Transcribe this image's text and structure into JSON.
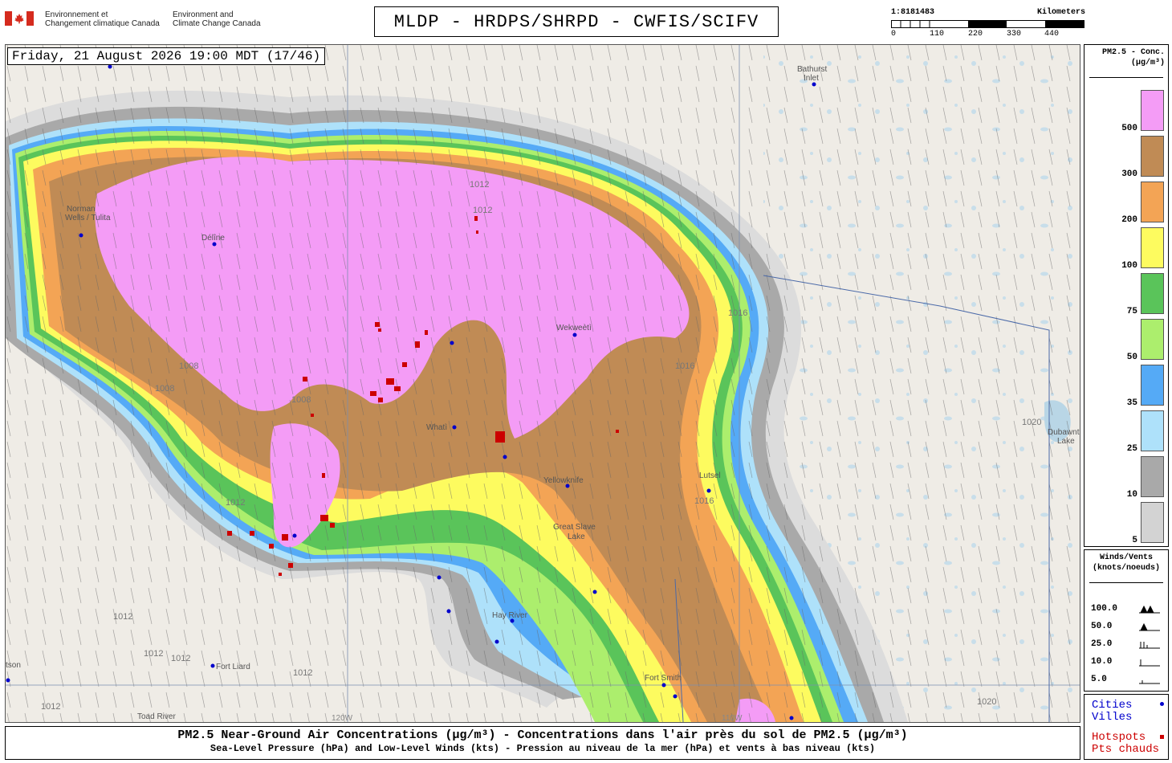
{
  "header": {
    "agency_fr": [
      "Environnement et",
      "Changement climatique Canada"
    ],
    "agency_en": [
      "Environment and",
      "Climate Change Canada"
    ],
    "title": "MLDP - HRDPS/SHRPD - CWFIS/SCIFV",
    "scale_ratio": "1:8181483",
    "scale_unit": "Kilometers",
    "scale_ticks": [
      "0",
      "110",
      "220",
      "330",
      "440"
    ]
  },
  "map": {
    "datetime": "Friday, 21 August 2026 19:00 MDT (17/46)",
    "places": [
      {
        "name": "Bathurst",
        "name2": "Inlet"
      },
      {
        "name": "Norman",
        "name2": "Wells / Tulita"
      },
      {
        "name": "Délîne"
      },
      {
        "name": "Wekweètì"
      },
      {
        "name": "Whatì"
      },
      {
        "name": "Yellowknife"
      },
      {
        "name": "Lutsel"
      },
      {
        "name": "Hay River"
      },
      {
        "name": "Fort Liard"
      },
      {
        "name": "Fort Smith"
      },
      {
        "name": "Toad River"
      },
      {
        "name": "Dubawnt",
        "name2": "Lake"
      },
      {
        "name": "Great Slave",
        "name2": "Lake"
      },
      {
        "name": "tson"
      }
    ],
    "isobars": [
      "1008",
      "1008",
      "1012",
      "1012",
      "1016",
      "1016",
      "1016",
      "1012",
      "1012",
      "1012",
      "1012",
      "1012",
      "1012",
      "1020",
      "1020",
      "1008"
    ],
    "meridians": [
      "120W",
      "110W"
    ]
  },
  "legend": {
    "pm_title": [
      "PM2.5 - Conc.",
      "(µg/m³)"
    ],
    "pm_bins": [
      {
        "label": "500",
        "color": "#f49cf6"
      },
      {
        "label": "300",
        "color": "#c08b55"
      },
      {
        "label": "200",
        "color": "#f3a455"
      },
      {
        "label": "100",
        "color": "#fdfb5f"
      },
      {
        "label": "75",
        "color": "#5ac45a"
      },
      {
        "label": "50",
        "color": "#acee6d"
      },
      {
        "label": "35",
        "color": "#55aaf6"
      },
      {
        "label": "25",
        "color": "#aee1fa"
      },
      {
        "label": "10",
        "color": "#a9a9a9"
      },
      {
        "label": "5",
        "color": "#d3d3d3"
      }
    ],
    "wind_title": [
      "Winds/Vents",
      "(knots/noeuds)"
    ],
    "wind_rows": [
      "100.0",
      "50.0",
      "25.0",
      "10.0",
      "5.0"
    ],
    "cities": [
      "Cities",
      "Villes"
    ],
    "hotspots": [
      "Hotspots",
      "Pts chauds"
    ],
    "city_color": "#0000cc",
    "hotspot_color": "#cc0000"
  },
  "footer": {
    "line1": "PM2.5 Near-Ground Air Concentrations (µg/m³) - Concentrations dans l'air près du sol de PM2.5 (µg/m³)",
    "line2": "Sea-Level Pressure (hPa) and Low-Level Winds (kts) - Pression au niveau de la mer (hPa) et vents à bas niveau (kts)"
  }
}
